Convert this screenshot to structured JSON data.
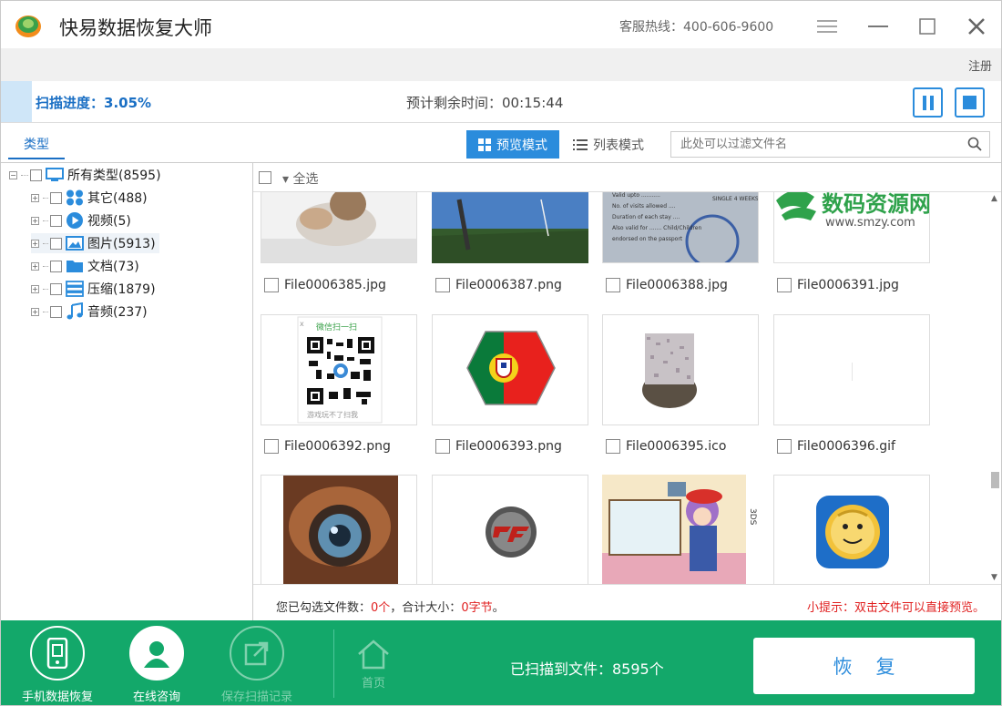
{
  "window": {
    "title": "快易数据恢复大师",
    "hotline": "客服热线：400-606-9600",
    "register": "注册"
  },
  "progress": {
    "label": "扫描进度：3.05%",
    "percent": 3.05,
    "remaining": "预计剩余时间：00:15:44"
  },
  "tabs": {
    "type": "类型"
  },
  "view": {
    "preview_mode": "预览模式",
    "list_mode": "列表模式"
  },
  "filter": {
    "placeholder": "此处可以过滤文件名"
  },
  "tree": {
    "root": "所有类型(8595)",
    "items": [
      {
        "label": "其它(488)",
        "icon": "grid-icon"
      },
      {
        "label": "视频(5)",
        "icon": "play-icon"
      },
      {
        "label": "图片(5913)",
        "icon": "image-icon"
      },
      {
        "label": "文档(73)",
        "icon": "folder-icon"
      },
      {
        "label": "压缩(1879)",
        "icon": "archive-icon"
      },
      {
        "label": "音频(237)",
        "icon": "music-icon"
      }
    ]
  },
  "grid": {
    "select_all": "全选",
    "row1": [
      "File0006385.jpg",
      "File0006387.png",
      "File0006388.jpg",
      "File0006391.jpg"
    ],
    "row2": [
      "File0006392.png",
      "File0006393.png",
      "File0006395.ico",
      "File0006396.gif"
    ],
    "thumb_text": {
      "smzy_logo": "数码资源网",
      "smzy_url": "www.smzy.com",
      "qr_top": "微信扫一扫",
      "qr_bottom": "游戏玩不了扫我",
      "qr_close": "x",
      "passport_lines": [
        "Valid upto ...........",
        "No. of visits allowed ....",
        "Duration of each stay ....",
        "Also valid for ....... Child/Children",
        "endorsed on the passport"
      ],
      "passport_stamp": "SINGLE 4 WEEKS",
      "game_side_label": "3DS"
    },
    "scroll_position": 0.74
  },
  "status": {
    "selected_prefix": "您已勾选文件数：",
    "selected_count": "0个",
    "size_prefix": "，合计大小：",
    "size_value": "0字节",
    "size_suffix": "。",
    "tip": "小提示：双击文件可以直接预览。"
  },
  "footer": {
    "phone_recovery": "手机数据恢复",
    "online_consult": "在线咨询",
    "save_record": "保存扫描记录",
    "home": "首页",
    "scanned": "已扫描到文件：8595个",
    "recover": "恢复"
  },
  "colors": {
    "accent": "#2b8cdc",
    "footer_green": "#13a86a",
    "warning_red": "#e02020"
  }
}
